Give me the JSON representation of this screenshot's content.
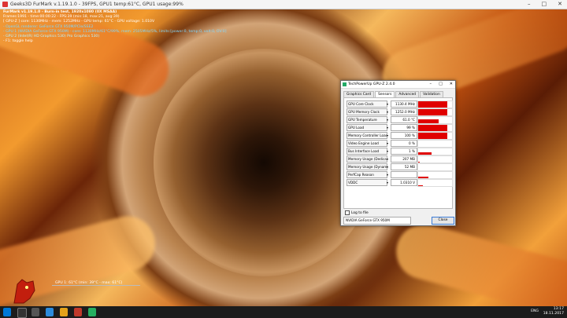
{
  "titlebar": {
    "title": "Geeks3D FurMark v.1.19.1.0 - 39FPS, GPU1 temp:61°C, GPU1 usage:99%",
    "btn_min": "–",
    "btn_max": "□",
    "btn_close": "✕"
  },
  "overlay": {
    "line1": "FurMark v1.19.1.0 - Burn-in test, 1920x1080 (0X MSAA)",
    "line2": "Frames:1991 - time:00:00:22 - FPS:39 (min:18, max:21, avg:39)",
    "line3": "[ GPU-Z ] core: 1130MHz - mem: 1252MHz - GPU temp: 61°C - GPU voltage: 1.010V",
    "line4": "- OpenGL renderer: GeForce GTX 950M/PCIe/SSE2",
    "line5": "- GPU 1 (NVIDIA GeForce GTX 950M) - core: 1130MHz/61°C/99%, mem: 2505MHz/5%, limits:[power:0, temp:0, volt:0, OV:0]",
    "line6": "- GPU 2 (Intel(R) HD Graphics 530) Pro Graphics 530)",
    "line7": "- F1: toggle help"
  },
  "graph_label": "GPU 1: 61°C (min: 39°C - max: 61°C)",
  "gpuz": {
    "title": "TechPowerUp GPU-Z 2.4.0",
    "tabs": [
      "Graphics Card",
      "Sensors",
      "Advanced",
      "Validation"
    ],
    "sensors": [
      {
        "label": "GPU Core Clock",
        "value": "1130.4 MHz",
        "level": 0.85
      },
      {
        "label": "GPU Memory Clock",
        "value": "1252.0 MHz",
        "level": 0.85
      },
      {
        "label": "GPU Temperature",
        "value": "61.0 °C",
        "level": 0.6
      },
      {
        "label": "GPU Load",
        "value": "99 %",
        "level": 0.85
      },
      {
        "label": "Memory Controller Load",
        "value": "100 %",
        "level": 0.85
      },
      {
        "label": "Video Engine Load",
        "value": "0 %",
        "level": 0
      },
      {
        "label": "Bus Interface Load",
        "value": "1 %",
        "level": 0.4
      },
      {
        "label": "Memory Usage (Dedicated)",
        "value": "207 MB",
        "level": 0.05
      },
      {
        "label": "Memory Usage (Dynamic)",
        "value": "52 MB",
        "level": 0
      },
      {
        "label": "PerfCap Reason",
        "value": "",
        "level": 0.3
      },
      {
        "label": "VDDC",
        "value": "1.0310 V",
        "level": 0.15
      }
    ],
    "log_label": "Log to file",
    "device": "NVIDIA GeForce GTX 950M",
    "close_label": "Close"
  },
  "taskbar": {
    "lang": "ENG",
    "time": "13:17",
    "date": "18.11.2017"
  },
  "colors": {
    "sensor_fill": "#e00000",
    "accent": "#3a7bd5"
  }
}
